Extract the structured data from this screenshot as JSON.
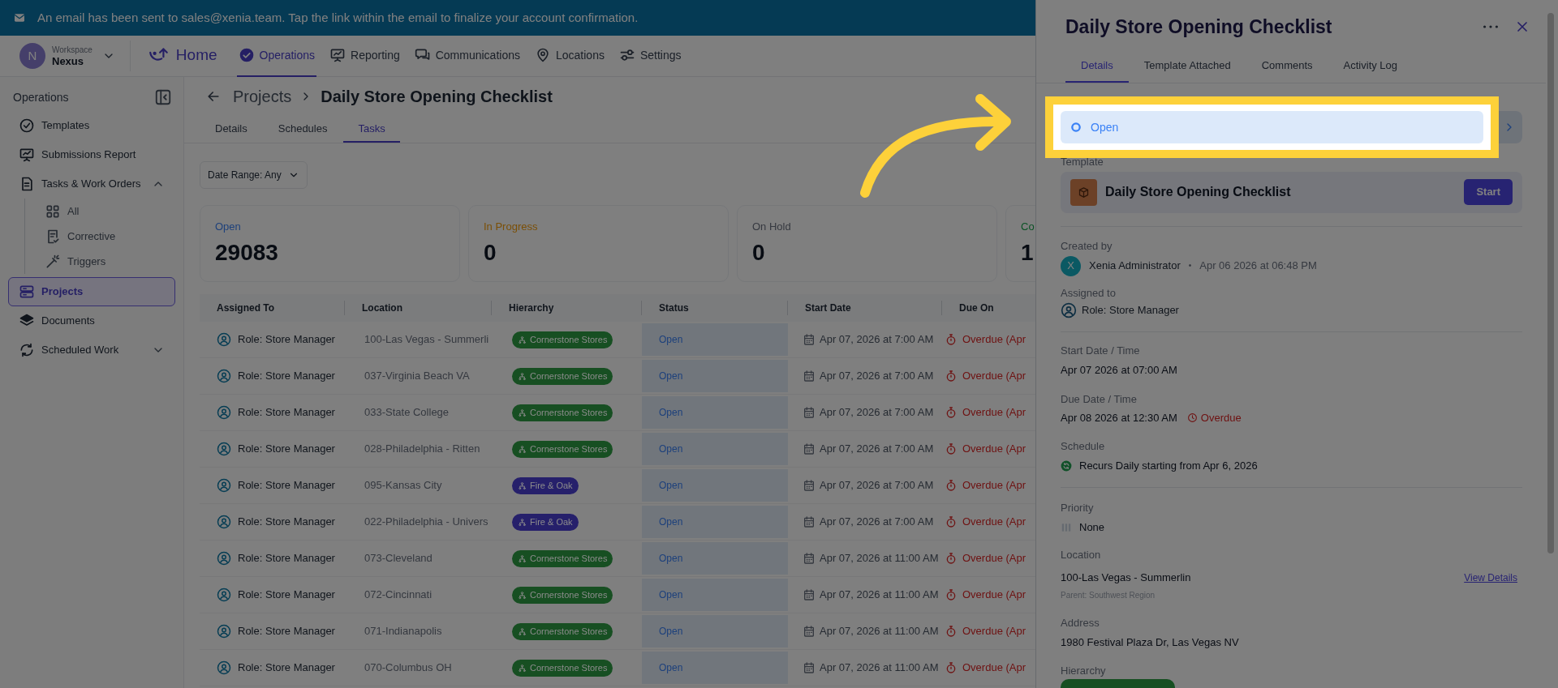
{
  "banner": {
    "text": "An email has been sent to sales@xenia.team. Tap the link within the email to finalize your account confirmation."
  },
  "workspace": {
    "initial": "N",
    "label": "Workspace",
    "name": "Nexus"
  },
  "nav": [
    {
      "label": "Home",
      "kind": "home",
      "selected": false
    },
    {
      "label": "Operations",
      "kind": "link",
      "selected": true
    },
    {
      "label": "Reporting",
      "kind": "link",
      "selected": false
    },
    {
      "label": "Communications",
      "kind": "link",
      "selected": false
    },
    {
      "label": "Locations",
      "kind": "link",
      "selected": false
    },
    {
      "label": "Settings",
      "kind": "link",
      "selected": false
    }
  ],
  "sidebar": {
    "title": "Operations",
    "items": [
      {
        "label": "Templates",
        "selected": false
      },
      {
        "label": "Submissions Report",
        "selected": false
      },
      {
        "label": "Tasks & Work Orders",
        "selected": false,
        "expanded": true,
        "children": [
          {
            "label": "All",
            "selected": false
          },
          {
            "label": "Corrective",
            "selected": false
          },
          {
            "label": "Triggers",
            "selected": false
          }
        ]
      },
      {
        "label": "Projects",
        "selected": true
      },
      {
        "label": "Documents",
        "selected": false
      },
      {
        "label": "Scheduled Work",
        "selected": false,
        "expanded": false
      }
    ]
  },
  "page": {
    "breadcrumb": {
      "parent": "Projects",
      "current": "Daily Store Opening Checklist"
    },
    "tabs": [
      {
        "label": "Details",
        "selected": false
      },
      {
        "label": "Schedules",
        "selected": false
      },
      {
        "label": "Tasks",
        "selected": true
      }
    ],
    "filter": "Date Range: Any",
    "stats": [
      {
        "label": "Open",
        "value": "29083",
        "color": "#1e417b"
      },
      {
        "label": "In Progress",
        "value": "0",
        "color": "#7b4f06"
      },
      {
        "label": "On Hold",
        "value": "0",
        "color": "#363940"
      },
      {
        "label": "Co",
        "value": "1",
        "color": "#0b5225"
      }
    ],
    "table": {
      "columns": [
        "Assigned To",
        "Location",
        "Hierarchy",
        "Status",
        "Start Date",
        "Due On"
      ],
      "rows": [
        {
          "assigned": "Role: Store Manager",
          "location": "100-Las Vegas - Summerli",
          "hierarchy": {
            "label": "Cornerstone Stores",
            "color": "#174f22"
          },
          "status": "Open",
          "start": "Apr 07, 2026 at 7:00 AM",
          "due": "Overdue (Apr"
        },
        {
          "assigned": "Role: Store Manager",
          "location": "037-Virginia Beach VA",
          "hierarchy": {
            "label": "Cornerstone Stores",
            "color": "#174f22"
          },
          "status": "Open",
          "start": "Apr 07, 2026 at 7:00 AM",
          "due": "Overdue (Apr"
        },
        {
          "assigned": "Role: Store Manager",
          "location": "033-State College",
          "hierarchy": {
            "label": "Cornerstone Stores",
            "color": "#174f22"
          },
          "status": "Open",
          "start": "Apr 07, 2026 at 7:00 AM",
          "due": "Overdue (Apr"
        },
        {
          "assigned": "Role: Store Manager",
          "location": "028-Philadelphia - Ritten",
          "hierarchy": {
            "label": "Cornerstone Stores",
            "color": "#174f22"
          },
          "status": "Open",
          "start": "Apr 07, 2026 at 7:00 AM",
          "due": "Overdue (Apr"
        },
        {
          "assigned": "Role: Store Manager",
          "location": "095-Kansas City",
          "hierarchy": {
            "label": "Fire & Oak",
            "color": "#26206b"
          },
          "status": "Open",
          "start": "Apr 07, 2026 at 7:00 AM",
          "due": "Overdue (Apr"
        },
        {
          "assigned": "Role: Store Manager",
          "location": "022-Philadelphia - Univers",
          "hierarchy": {
            "label": "Fire & Oak",
            "color": "#26206b"
          },
          "status": "Open",
          "start": "Apr 07, 2026 at 7:00 AM",
          "due": "Overdue (Apr"
        },
        {
          "assigned": "Role: Store Manager",
          "location": "073-Cleveland",
          "hierarchy": {
            "label": "Cornerstone Stores",
            "color": "#174f22"
          },
          "status": "Open",
          "start": "Apr 07, 2026 at 11:00 AM",
          "due": "Overdue (Apr"
        },
        {
          "assigned": "Role: Store Manager",
          "location": "072-Cincinnati",
          "hierarchy": {
            "label": "Cornerstone Stores",
            "color": "#174f22"
          },
          "status": "Open",
          "start": "Apr 07, 2026 at 11:00 AM",
          "due": "Overdue (Apr"
        },
        {
          "assigned": "Role: Store Manager",
          "location": "071-Indianapolis",
          "hierarchy": {
            "label": "Cornerstone Stores",
            "color": "#174f22"
          },
          "status": "Open",
          "start": "Apr 07, 2026 at 11:00 AM",
          "due": "Overdue (Apr"
        },
        {
          "assigned": "Role: Store Manager",
          "location": "070-Columbus OH",
          "hierarchy": {
            "label": "Cornerstone Stores",
            "color": "#174f22"
          },
          "status": "Open",
          "start": "Apr 07, 2026 at 11:00 AM",
          "due": "Overdue (Apr"
        }
      ]
    }
  },
  "panel": {
    "title": "Daily Store Opening Checklist",
    "tabs": [
      {
        "label": "Details",
        "selected": true
      },
      {
        "label": "Template Attached",
        "selected": false
      },
      {
        "label": "Comments",
        "selected": false
      },
      {
        "label": "Activity Log",
        "selected": false
      }
    ],
    "status": {
      "value": "Open"
    },
    "template": {
      "label": "Template",
      "name": "Daily Store Opening Checklist",
      "button": "Start"
    },
    "created_by": {
      "label": "Created by",
      "initial": "X",
      "name": "Xenia Administrator",
      "separator": "•",
      "time": "Apr 06 2026 at 06:48 PM"
    },
    "assigned_to": {
      "label": "Assigned to",
      "value": "Role: Store Manager"
    },
    "start": {
      "label": "Start Date / Time",
      "value": "Apr 07 2026 at 07:00 AM"
    },
    "due": {
      "label": "Due Date / Time",
      "value": "Apr 08 2026 at 12:30 AM",
      "badge": "Overdue"
    },
    "schedule": {
      "label": "Schedule",
      "value": "Recurs Daily starting from Apr 6, 2026"
    },
    "priority": {
      "label": "Priority",
      "value": "None"
    },
    "location": {
      "label": "Location",
      "value": "100-Las Vegas - Summerlin",
      "parent": "Parent: Southwest Region",
      "link": "View Details"
    },
    "address": {
      "label": "Address",
      "value": "1980 Festival Plaza Dr, Las Vegas NV"
    },
    "hierarchy": {
      "label": "Hierarchy"
    }
  }
}
